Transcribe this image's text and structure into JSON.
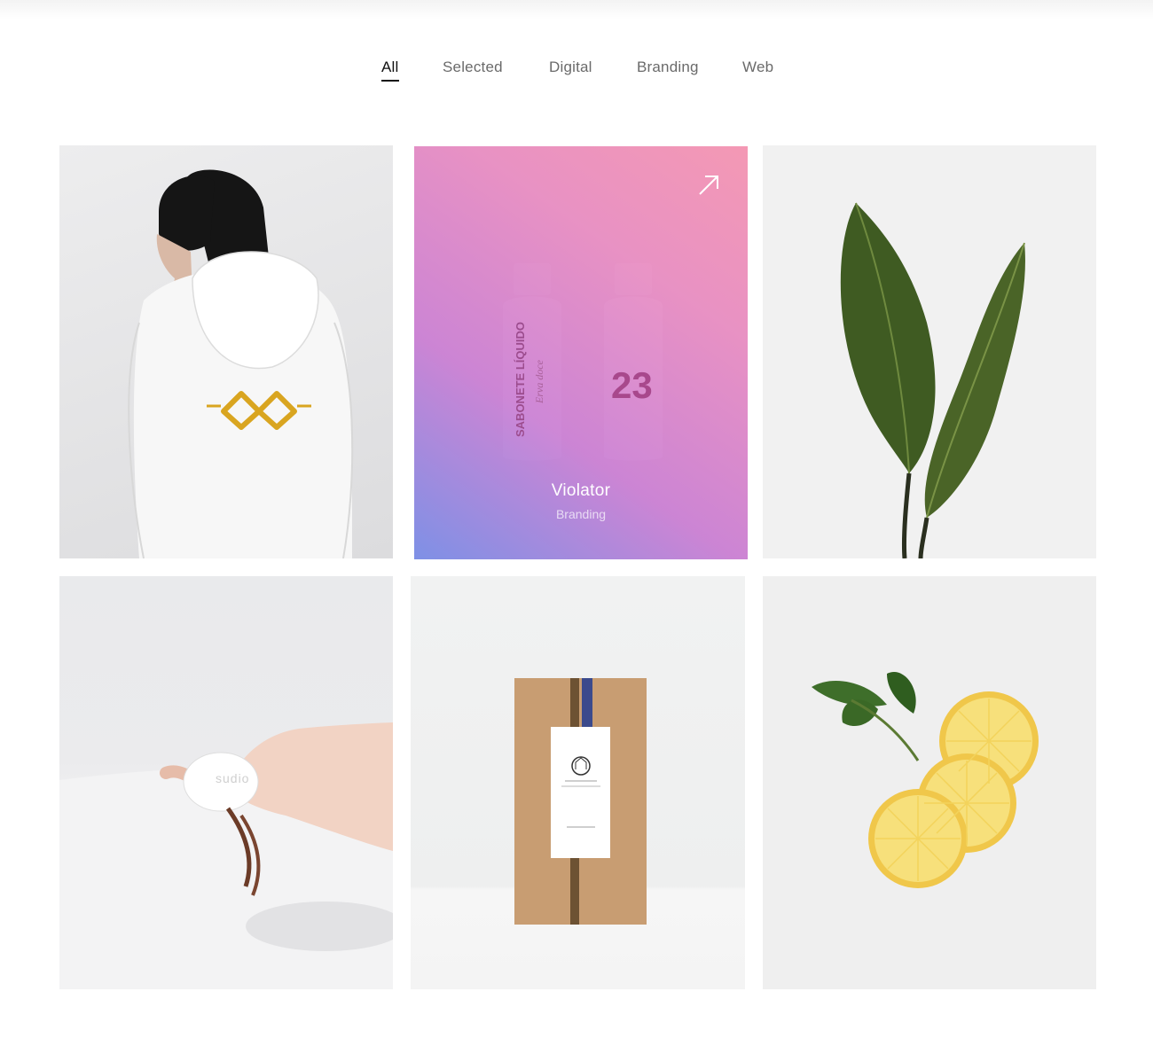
{
  "filters": {
    "items": [
      {
        "label": "All",
        "active": true
      },
      {
        "label": "Selected",
        "active": false
      },
      {
        "label": "Digital",
        "active": false
      },
      {
        "label": "Branding",
        "active": false
      },
      {
        "label": "Web",
        "active": false
      }
    ]
  },
  "portfolio": {
    "hover_tile": {
      "title": "Violator",
      "category": "Branding",
      "bottle_left_label": "SABONETE LÍQUIDO",
      "bottle_left_sub": "Erva doce",
      "bottle_right_number": "23"
    },
    "soap_brand": "sudio"
  },
  "colors": {
    "active_filter": "#111111",
    "inactive_filter": "#6a6a6a",
    "overlay_start": "#788ce6",
    "overlay_end": "#f591af"
  },
  "icons": [
    "arrow-up-right-icon"
  ]
}
